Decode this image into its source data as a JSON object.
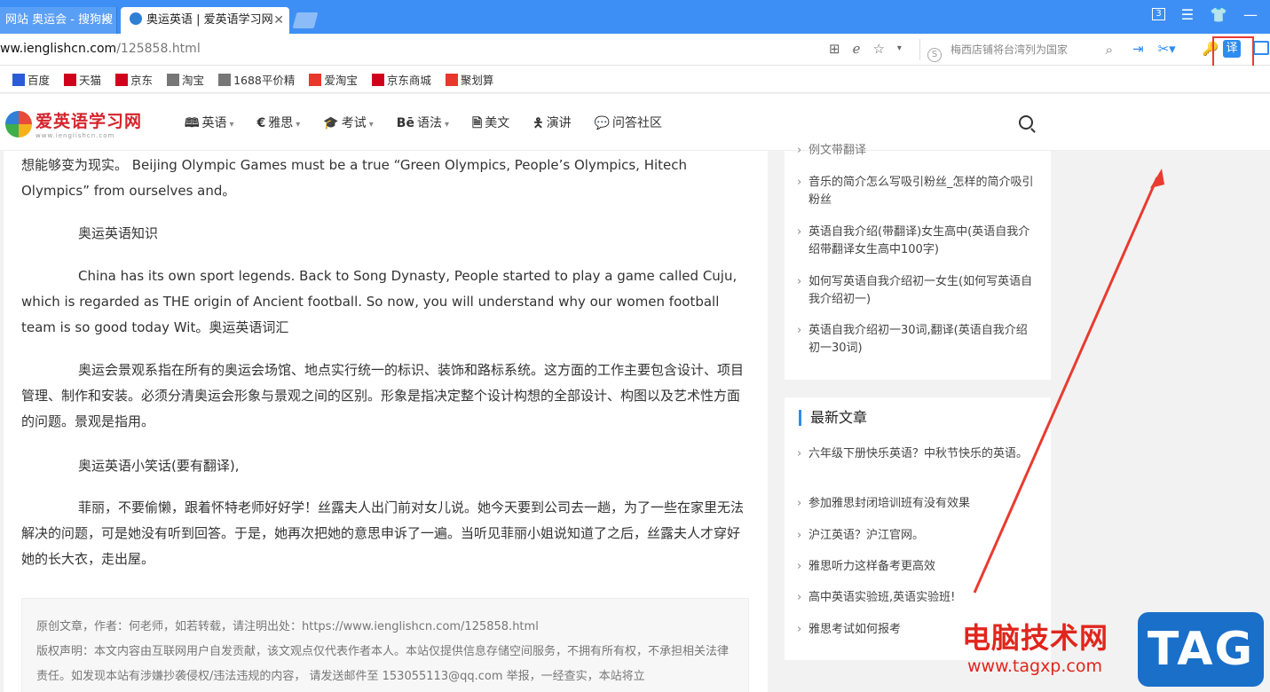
{
  "tabs": [
    {
      "label": "网站 奥运会 - 搜狗搜"
    },
    {
      "label": "奥运英语 | 爱英语学习网"
    }
  ],
  "address": {
    "domain": "ww.ienglishcn.com",
    "path": "/125858.html"
  },
  "search_box": {
    "placeholder": "梅西店铺将台湾列为国家"
  },
  "toolbar": {
    "translate_label": "译",
    "tab_count": "3"
  },
  "bookmarks": [
    {
      "label": "百度",
      "color": "#2b5bd7"
    },
    {
      "label": "天猫",
      "color": "#d0021b"
    },
    {
      "label": "京东",
      "color": "#d0021b"
    },
    {
      "label": "淘宝",
      "color": "#777777"
    },
    {
      "label": "1688平价精",
      "color": "#777777"
    },
    {
      "label": "爱淘宝",
      "color": "#e8382c"
    },
    {
      "label": "京东商城",
      "color": "#d0021b"
    },
    {
      "label": "聚划算",
      "color": "#e8382c"
    }
  ],
  "site": {
    "logo_cn": "爱英语学习网",
    "logo_en": "www.ienglishcn.com",
    "nav": [
      {
        "label": "英语",
        "dropdown": true
      },
      {
        "label": "雅思",
        "dropdown": true
      },
      {
        "label": "考试",
        "dropdown": true
      },
      {
        "label": "语法",
        "dropdown": true
      },
      {
        "label": "美文",
        "dropdown": false
      },
      {
        "label": "演讲",
        "dropdown": false
      },
      {
        "label": "问答社区",
        "dropdown": false
      }
    ]
  },
  "article": {
    "p1": "想能够变为现实。 Beijing Olympic Games must be a true “Green Olympics, People’s Olympics, Hitech Olympics” from ourselves and。",
    "h1": "奥运英语知识",
    "p2": "China has its own sport legends. Back to Song Dynasty, People started to play a game called Cuju, which is regarded as THE origin of Ancient football. So now, you will understand why our women football team is so good today Wit。奥运英语词汇",
    "p3": "奥运会景观系指在所有的奥运会场馆、地点实行统一的标识、装饰和路标系统。这方面的工作主要包含设计、项目管理、制作和安装。必须分清奥运会形象与景观之间的区别。形象是指决定整个设计构想的全部设计、构图以及艺术性方面的问题。景观是指用。",
    "h2": "奥运英语小笑话(要有翻译),",
    "p4": "菲丽，不要偷懒，跟着怀特老师好好学！丝露夫人出门前对女儿说。她今天要到公司去一趟，为了一些在家里无法解决的问题，可是她没有听到回答。于是，她再次把她的意思申诉了一遍。当听见菲丽小姐说知道了之后，丝露夫人才穿好她的长大衣，走出屋。",
    "footer_line1": "原创文章，作者：何老师，如若转载，请注明出处：https://www.ienglishcn.com/125858.html",
    "footer_line2": "版权声明：本文内容由互联网用户自发贡献，该文观点仅代表作者本人。本站仅提供信息存储空间服务，不拥有所有权，不承担相关法律责任。如发现本站有涉嫌抄袭侵权/违法违规的内容， 请发送邮件至 153055113@qq.com 举报，一经查实，本站将立"
  },
  "sidebar1": {
    "items": [
      "例文带翻译",
      "音乐的简介怎么写吸引粉丝_怎样的简介吸引粉丝",
      "英语自我介绍(带翻译)女生高中(英语自我介绍带翻译女生高中100字)",
      "如何写英语自我介绍初一女生(如何写英语自我介绍初一)",
      "英语自我介绍初一30词,翻译(英语自我介绍初一30词)"
    ]
  },
  "sidebar2": {
    "title": "最新文章",
    "items": [
      "六年级下册快乐英语？中秋节快乐的英语。",
      "参加雅思封闭培训班有没有效果",
      "沪江英语？沪江官网。",
      "雅思听力这样备考更高效",
      "高中英语实验班,英语实验班!",
      "雅思考试如何报考"
    ]
  },
  "watermark": {
    "cn": "电脑技术网",
    "url": "www.tagxp.com",
    "tag": "TAG"
  },
  "colors": {
    "tabbar": "#3d8ff5",
    "accent": "#2d8cf0",
    "highlight": "#e93b30"
  }
}
